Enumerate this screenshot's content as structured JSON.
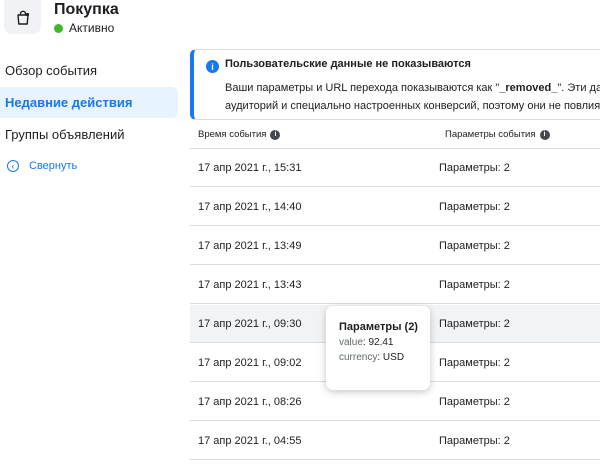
{
  "event": {
    "icon": "shopping-bag-icon",
    "title": "Покупка",
    "status": "Активно",
    "status_color": "#42b72a"
  },
  "sidebar": {
    "items": [
      {
        "label": "Обзор события",
        "active": false
      },
      {
        "label": "Недавние действия",
        "active": true
      },
      {
        "label": "Группы объявлений",
        "active": false
      }
    ],
    "collapse_label": "Свернуть"
  },
  "notice": {
    "icon": "info-icon",
    "title": "Пользовательские данные не показываются",
    "body_line1_before": "Ваши параметры и URL перехода показываются как \"",
    "body_line1_highlight": "_removed_",
    "body_line1_after": "\". Эти данные",
    "body_line2": "аудиторий и специально настроенных конверсий, поэтому они не повлияют"
  },
  "table": {
    "columns": [
      "Время события",
      "Параметры события"
    ],
    "rows": [
      {
        "time": "17 апр 2021 г., 15:31",
        "params": "Параметры: 2"
      },
      {
        "time": "17 апр 2021 г., 14:40",
        "params": "Параметры: 2"
      },
      {
        "time": "17 апр 2021 г., 13:49",
        "params": "Параметры: 2"
      },
      {
        "time": "17 апр 2021 г., 13:43",
        "params": "Параметры: 2"
      },
      {
        "time": "17 апр 2021 г., 09:30",
        "params": "Параметры: 2"
      },
      {
        "time": "17 апр 2021 г., 09:02",
        "params": "Параметры: 2"
      },
      {
        "time": "17 апр 2021 г., 08:26",
        "params": "Параметры: 2"
      },
      {
        "time": "17 апр 2021 г., 04:55",
        "params": "Параметры: 2"
      }
    ]
  },
  "tooltip": {
    "title": "Параметры (2)",
    "params": [
      {
        "key": "value",
        "value": "92.41"
      },
      {
        "key": "currency",
        "value": "USD"
      }
    ]
  },
  "colors": {
    "accent": "#1877f2",
    "active_bg": "#e7f3ff",
    "border": "#dadde1",
    "hover_row": "#f2f3f5"
  }
}
